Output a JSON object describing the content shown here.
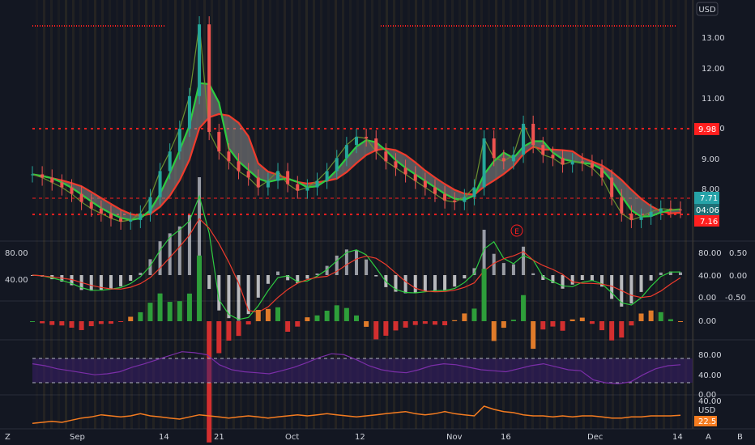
{
  "currency_button": "USD",
  "corner": {
    "left": "Z",
    "a": "A",
    "b": "B"
  },
  "price_panel": {
    "ylim": [
      6.9,
      13.9
    ],
    "ticks": [
      "13.00",
      "12.00",
      "11.00",
      "10.00",
      "9.00",
      "8.00"
    ],
    "levels": {
      "resistance": 9.98,
      "support": 7.16,
      "mid": 7.71
    },
    "tags": {
      "resistance": "9.98",
      "last": "7.71",
      "countdown": "04:06",
      "support": "7.16"
    },
    "earnings_marker": "E",
    "colors": {
      "resistance": "#ff1f1f",
      "last_tag": "#26a3a8",
      "countdown_tag": "#1e6f75",
      "sma_red": "#ef3b2c",
      "ema_green": "#2ecc40",
      "cloud": "#8c8c8c"
    }
  },
  "macd_panel": {
    "left_ticks": [
      "80.00",
      "40.00"
    ],
    "right_ticks": [
      "80.00",
      "40.00",
      "0.00"
    ],
    "far_right_ticks": [
      "0.50",
      "0.00",
      "-0.50"
    ]
  },
  "histogram_panel": {
    "ticks": [
      "0.00"
    ]
  },
  "rsi_panel": {
    "ticks": [
      "80.00",
      "40.00",
      "0.00"
    ],
    "band_color": "#3a1f6b",
    "line_color": "#7b2ea8"
  },
  "volatility_panel": {
    "ticks": [
      "40.00"
    ],
    "tag": "22.5",
    "unit": "USD",
    "line_color": "#f57c20"
  },
  "time_axis": [
    "Sep",
    "14",
    "21",
    "Oct",
    "12",
    "Nov",
    "16",
    "Dec",
    "14"
  ],
  "chart_data": {
    "type": "line",
    "title": "",
    "xlabel": "",
    "ylabel": "",
    "series": [
      {
        "values": [
          8.8,
          8.7,
          8.55,
          8.4,
          8.2,
          7.95,
          7.75,
          7.6,
          7.45,
          7.35,
          7.4,
          7.6,
          8.1,
          8.9,
          9.5,
          10.2,
          11.2,
          13.4,
          10.1,
          9.5,
          9.2,
          8.9,
          8.7,
          8.4,
          8.6,
          8.9,
          8.5,
          8.3,
          8.4,
          8.6,
          8.9,
          9.3,
          9.7,
          9.95,
          9.9,
          9.5,
          9.2,
          9.0,
          8.8,
          8.6,
          8.4,
          8.2,
          8.0,
          7.95,
          8.1,
          8.4,
          9.9,
          9.3,
          9.2,
          9.4,
          10.35,
          9.7,
          9.4,
          9.3,
          9.1,
          9.2,
          9.15,
          9.0,
          8.7,
          8.1,
          7.6,
          7.4,
          7.5,
          7.65,
          7.75,
          7.72,
          7.71
        ]
      }
    ],
    "volatility": [
      15,
      16,
      17,
      16,
      18,
      20,
      21,
      23,
      22,
      21,
      22,
      24,
      22,
      21,
      20,
      19,
      21,
      23,
      22,
      21,
      20,
      21,
      22,
      21,
      20,
      21,
      22,
      23,
      22,
      23,
      24,
      23,
      22,
      21,
      22,
      23,
      24,
      25,
      26,
      24,
      23,
      24,
      26,
      24,
      23,
      22,
      31,
      28,
      26,
      25,
      23,
      22,
      22,
      21,
      22,
      21,
      22,
      22,
      21,
      20,
      20,
      21,
      21,
      22,
      22,
      22,
      22.5
    ],
    "rsi": [
      62,
      58,
      52,
      48,
      44,
      40,
      42,
      46,
      55,
      62,
      70,
      78,
      86,
      84,
      80,
      60,
      50,
      46,
      44,
      42,
      48,
      55,
      64,
      74,
      82,
      80,
      70,
      58,
      50,
      46,
      44,
      50,
      58,
      62,
      60,
      55,
      50,
      48,
      46,
      52,
      58,
      62,
      56,
      50,
      48,
      30,
      24,
      22,
      26,
      40,
      52,
      58,
      60
    ],
    "ylim": [
      6.9,
      13.9
    ]
  }
}
